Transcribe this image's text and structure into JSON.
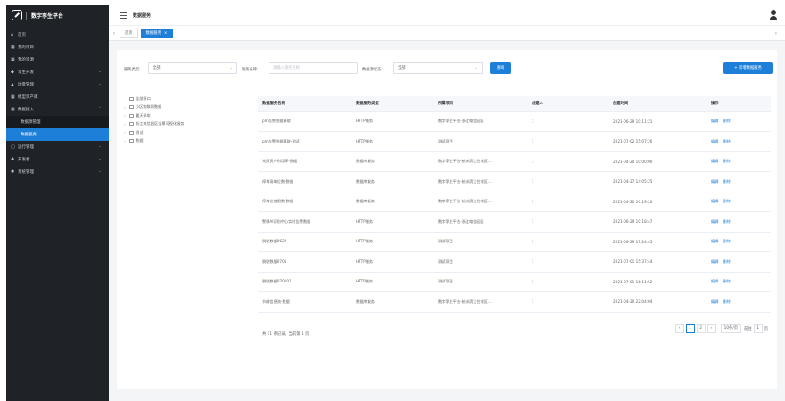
{
  "app": {
    "title": "数字孪生平台"
  },
  "sidebar": {
    "items": [
      {
        "label": "首页",
        "icon": "home-icon",
        "glyph": "⌂"
      },
      {
        "label": "我的项目",
        "icon": "grid-icon",
        "glyph": "▦"
      },
      {
        "label": "我的资源",
        "icon": "grid-icon",
        "glyph": "▦"
      },
      {
        "label": "孪生开发",
        "icon": "bulb-icon",
        "glyph": "◆",
        "arrow": "⌄"
      },
      {
        "label": "场景管理",
        "icon": "mountain-icon",
        "glyph": "▲",
        "arrow": "⌄"
      },
      {
        "label": "模型资产库",
        "icon": "grid-icon",
        "glyph": "▦"
      },
      {
        "label": "数据接入",
        "icon": "grid-icon",
        "glyph": "▦",
        "arrow": "⌃"
      },
      {
        "label": "数据源管理",
        "sub": true
      },
      {
        "label": "数据服务",
        "sub": true,
        "active": true
      },
      {
        "label": "运行管理",
        "icon": "monitor-icon",
        "glyph": "▢",
        "arrow": "⌄"
      },
      {
        "label": "开发者",
        "icon": "puzzle-icon",
        "glyph": "✚",
        "arrow": "⌄"
      },
      {
        "label": "系统管理",
        "icon": "gear-icon",
        "glyph": "✱",
        "arrow": "⌄"
      }
    ]
  },
  "header": {
    "breadcrumb": "数据服务"
  },
  "tabs": [
    {
      "label": "首页"
    },
    {
      "label": "数据服务",
      "active": true,
      "close": "×"
    }
  ],
  "tabs_nav": {
    "left": "‹",
    "right": "›"
  },
  "filters": {
    "type_label": "服务类型:",
    "type_value": "全部",
    "name_label": "服务名称:",
    "name_placeholder": "请输入服务名称",
    "status_label": "数据源状态:",
    "status_value": "全部",
    "query_button": "查询",
    "new_button": "+ 新增数据服务"
  },
  "tree": [
    {
      "label": "全部接口",
      "caret": ""
    },
    {
      "label": "小区物联网数据",
      "caret": "›"
    },
    {
      "label": "露天停车",
      "caret": "›"
    },
    {
      "label": "浙江电信园区全景可视化服务",
      "caret": "›"
    },
    {
      "label": "测试",
      "caret": "›"
    },
    {
      "label": "数据",
      "caret": "›"
    }
  ],
  "table": {
    "columns": [
      "数据服务名称",
      "数据服务类型",
      "所属项目",
      "创建人",
      "创建时间",
      "操作"
    ],
    "rows": [
      [
        "pm告警数据获取",
        "HTTP服务",
        "数字孪生平台-浙江电信园区",
        "1",
        "2021-06-29 10:11:21"
      ],
      [
        "pm告警数据获取-测试",
        "HTTP服务",
        "测试项目",
        "1",
        "2021-07-02 15:07:26"
      ],
      [
        "光照资产利用率-数据",
        "数据库服务",
        "数字孪生平台-杭州滨江住宅区...",
        "1",
        "2021-04-20 10:00:00"
      ],
      [
        "停车场车位数-数据",
        "数据库服务",
        "数字孪生平台-杭州滨江住宅区...",
        "1",
        "2021-04-27 14:05:25"
      ],
      [
        "停车位使用数-数据",
        "数据库服务",
        "数字孪生平台-杭州滨江住宅区...",
        "1",
        "2021-04-20 10:19:20"
      ],
      [
        "警情AI识别中心实时告警数据",
        "HTTP服务",
        "数字孪生平台-浙江电信园区",
        "1",
        "2021-06-29 10:18:47"
      ],
      [
        "税收数据0629",
        "HTTP服务",
        "测试项目",
        "1",
        "2021-06-29 17:24:45"
      ],
      [
        "税收数据0701",
        "HTTP服务",
        "测试项目",
        "1",
        "2021-07-01 15:37:44"
      ],
      [
        "税收数据070101",
        "HTTP服务",
        "测试项目",
        "1",
        "2021-07-01 16:11:52"
      ],
      [
        "节能信息流-数据",
        "数据库服务",
        "数字孪生平台-杭州滨江住宅区...",
        "1",
        "2021-04-20 22:04:04"
      ]
    ],
    "ops": [
      "编辑",
      "删除"
    ]
  },
  "pagination": {
    "total_text": "共 11 条记录，当前第 1 页",
    "prev": "‹",
    "pages": [
      "1",
      "2"
    ],
    "current": "1",
    "next": "›",
    "page_size": "10条/页",
    "goto_label": "前往",
    "goto_value": "1",
    "goto_suffix": "页"
  },
  "colors": {
    "accent": "#1e7fd8",
    "sidebar_bg": "#1f2227",
    "content_bg": "#f4f5f7"
  }
}
